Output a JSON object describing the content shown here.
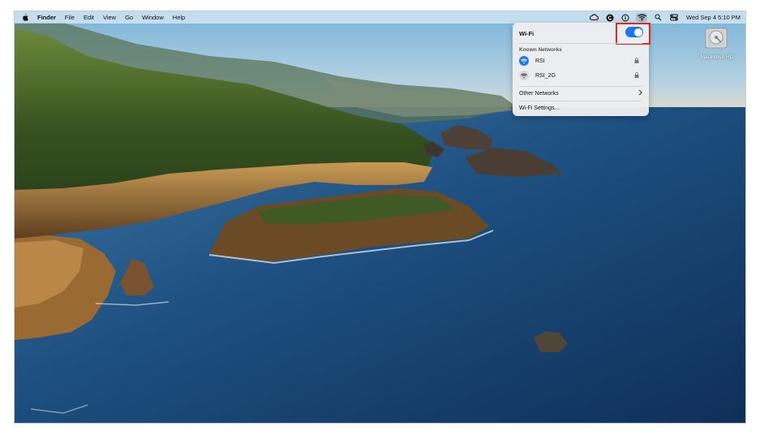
{
  "menubar": {
    "app_name": "Finder",
    "menus": [
      "File",
      "Edit",
      "View",
      "Go",
      "Window",
      "Help"
    ],
    "date_time": "Wed Sep 4  5:10 PM",
    "status_icons": [
      "creative-cloud-icon",
      "grammarly-icon",
      "password-manager-icon",
      "wifi-icon",
      "spotlight-search-icon",
      "control-center-icon"
    ]
  },
  "wifi_panel": {
    "title": "Wi-Fi",
    "enabled": true,
    "known_networks_label": "Known Networks",
    "known_networks": [
      {
        "name": "RSI",
        "connected": true,
        "secured": true
      },
      {
        "name": "RSI_2G",
        "connected": false,
        "secured": true
      }
    ],
    "other_networks_label": "Other Networks",
    "settings_label": "Wi-Fi Settings..."
  },
  "desktop": {
    "drive_label": "Macintosh HD"
  },
  "colors": {
    "accent": "#1f75f0",
    "highlight_box": "#e02a1f"
  }
}
